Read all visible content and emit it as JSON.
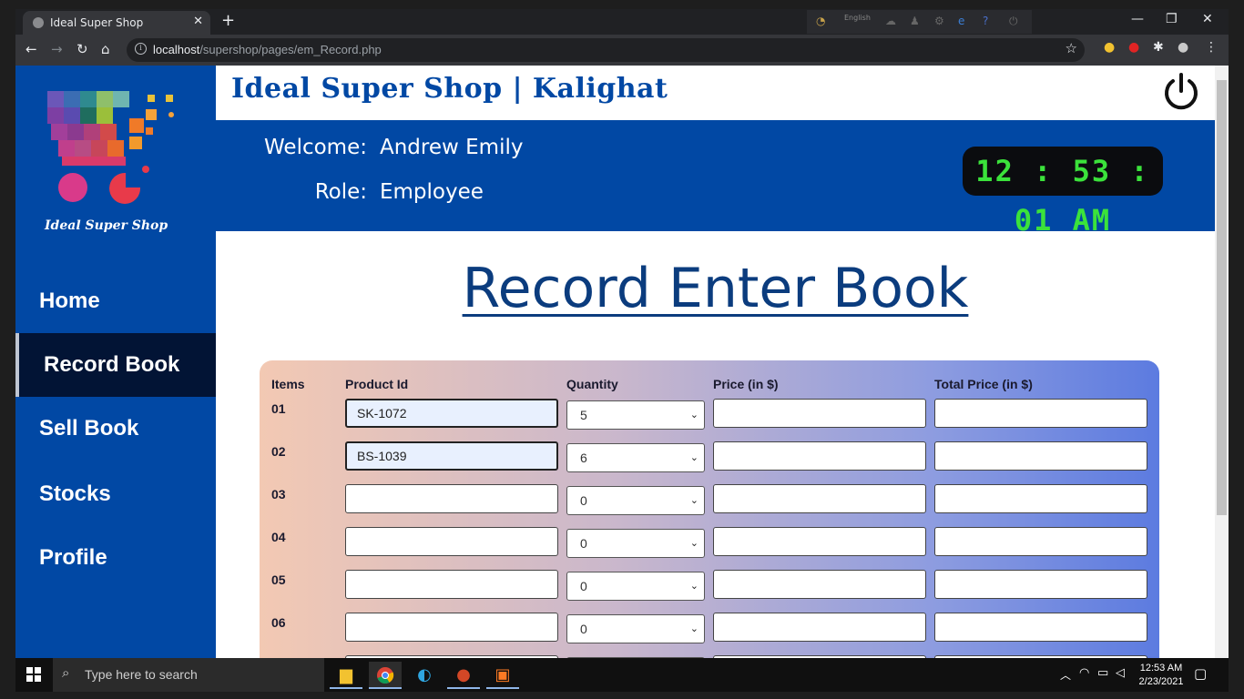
{
  "browser": {
    "tab_title": "Ideal Super Shop",
    "tab_close": "✕",
    "new_tab": "+",
    "language": "English",
    "url_host": "localhost",
    "url_path": "/supershop/pages/em_Record.php",
    "window_controls": [
      "—",
      "❐",
      "✕"
    ]
  },
  "sidebar": {
    "logo_text": "Ideal Super Shop",
    "items": [
      {
        "label": "Home",
        "active": false
      },
      {
        "label": "Record Book",
        "active": true
      },
      {
        "label": "Sell Book",
        "active": false
      },
      {
        "label": "Stocks",
        "active": false
      },
      {
        "label": "Profile",
        "active": false
      }
    ]
  },
  "header": {
    "shop_title": "Ideal Super Shop | Kalighat",
    "welcome_label": "Welcome:",
    "welcome_value": "Andrew Emily",
    "role_label": "Role:",
    "role_value": "Employee",
    "clock": "12 : 53 : 01 AM",
    "power_icon": "power-icon"
  },
  "main": {
    "heading": "Record Enter Book",
    "columns": [
      "Items",
      "Product Id",
      "Quantity",
      "Price (in $)",
      "Total Price (in $)"
    ],
    "rows": [
      {
        "item": "01",
        "product_id": "SK-1072",
        "quantity": "5",
        "price": "",
        "total": ""
      },
      {
        "item": "02",
        "product_id": "BS-1039",
        "quantity": "6",
        "price": "",
        "total": ""
      },
      {
        "item": "03",
        "product_id": "",
        "quantity": "0",
        "price": "",
        "total": ""
      },
      {
        "item": "04",
        "product_id": "",
        "quantity": "0",
        "price": "",
        "total": ""
      },
      {
        "item": "05",
        "product_id": "",
        "quantity": "0",
        "price": "",
        "total": ""
      },
      {
        "item": "06",
        "product_id": "",
        "quantity": "0",
        "price": "",
        "total": ""
      }
    ]
  },
  "taskbar": {
    "search_placeholder": "Type here to search",
    "time": "12:53 AM",
    "date": "2/23/2021"
  },
  "colors": {
    "brand_blue": "#0148a4",
    "active_nav": "#021435",
    "clock_green": "#3be23b",
    "heading": "#0b3c7e"
  }
}
